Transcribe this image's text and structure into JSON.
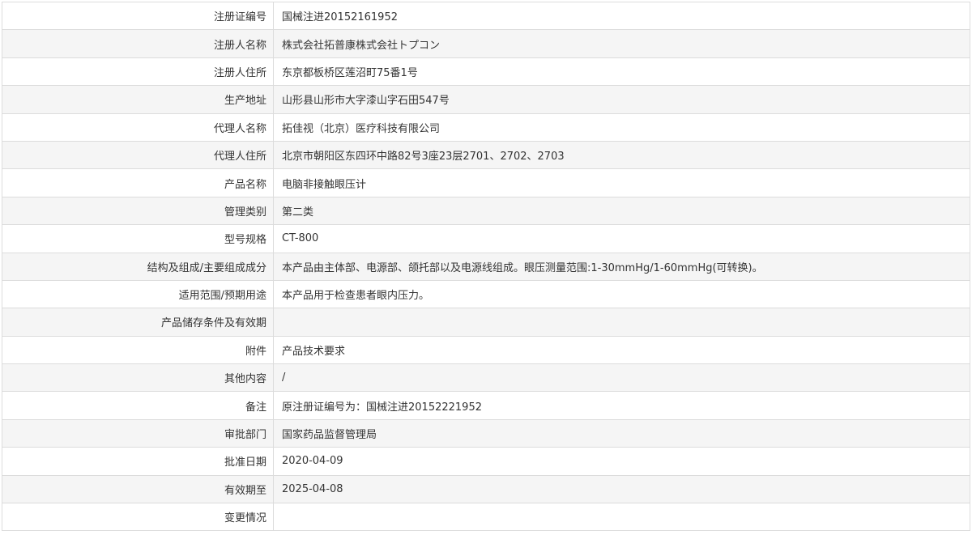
{
  "rows": [
    {
      "label": "注册证编号",
      "value": "国械注进20152161952"
    },
    {
      "label": "注册人名称",
      "value": "株式会社拓普康株式会社トプコン"
    },
    {
      "label": "注册人住所",
      "value": "东京都板桥区莲沼町75番1号"
    },
    {
      "label": "生产地址",
      "value": "山形县山形市大字漆山字石田547号"
    },
    {
      "label": "代理人名称",
      "value": "拓佳视（北京）医疗科技有限公司"
    },
    {
      "label": "代理人住所",
      "value": "北京市朝阳区东四环中路82号3座23层2701、2702、2703"
    },
    {
      "label": "产品名称",
      "value": "电脑非接触眼压计"
    },
    {
      "label": "管理类别",
      "value": "第二类"
    },
    {
      "label": "型号规格",
      "value": "CT-800"
    },
    {
      "label": "结构及组成/主要组成成分",
      "value": "本产品由主体部、电源部、颌托部以及电源线组成。眼压测量范围:1-30mmHg/1-60mmHg(可转换)。"
    },
    {
      "label": "适用范围/预期用途",
      "value": "本产品用于检查患者眼内压力。"
    },
    {
      "label": "产品储存条件及有效期",
      "value": ""
    },
    {
      "label": "附件",
      "value": "产品技术要求"
    },
    {
      "label": "其他内容",
      "value": "/"
    },
    {
      "label": "备注",
      "value": "原注册证编号为：国械注进20152221952"
    },
    {
      "label": "审批部门",
      "value": "国家药品监督管理局"
    },
    {
      "label": "批准日期",
      "value": "2020-04-09"
    },
    {
      "label": "有效期至",
      "value": "2025-04-08"
    },
    {
      "label": "变更情况",
      "value": ""
    }
  ]
}
